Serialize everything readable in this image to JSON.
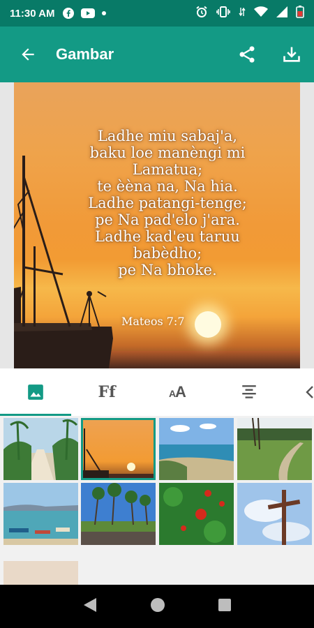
{
  "status_bar": {
    "time": "11:30 AM",
    "left_icons": [
      "facebook-icon",
      "youtube-icon",
      "dot-icon"
    ],
    "right_icons": [
      "alarm-icon",
      "vibrate-icon",
      "data-icon",
      "wifi-icon",
      "signal-icon",
      "battery-icon"
    ]
  },
  "app_bar": {
    "title": "Gambar",
    "back_icon": "arrow-left-icon",
    "actions": [
      "share-icon",
      "download-icon"
    ]
  },
  "preview": {
    "verse_lines": [
      "Ladhe miu sabaj'a,",
      "baku loe manèngi mi",
      "Lamatua;",
      "te èèna na, Na hia.",
      "Ladhe patangi-tenge;",
      "pe Na pad'elo j'ara.",
      "Ladhe kad'eu taruu",
      "babèdho;",
      "pe Na bhoke."
    ],
    "reference": "Mateos 7:7"
  },
  "tabs": [
    {
      "name": "image",
      "icon": "image-icon",
      "label": ""
    },
    {
      "name": "font",
      "icon": "font-icon",
      "label": "Ff"
    },
    {
      "name": "text-size",
      "icon": "text-size-icon",
      "label": "AA"
    },
    {
      "name": "align",
      "icon": "align-center-icon",
      "label": ""
    },
    {
      "name": "more",
      "icon": "chevron-left-icon",
      "label": ""
    }
  ],
  "active_tab": "image",
  "gallery": [
    {
      "name": "palm-beach-path",
      "selected": false
    },
    {
      "name": "sunset-ship",
      "selected": true
    },
    {
      "name": "coast-island",
      "selected": false
    },
    {
      "name": "grass-path-trees",
      "selected": false
    },
    {
      "name": "harbor-boats",
      "selected": false
    },
    {
      "name": "palm-grove",
      "selected": false
    },
    {
      "name": "red-flowers-tree",
      "selected": false
    },
    {
      "name": "cross-sky",
      "selected": false
    },
    {
      "name": "partial-beige",
      "selected": false
    }
  ],
  "colors": {
    "primary": "#139a85",
    "status_bar": "#087a67",
    "nav_bar": "#000000"
  }
}
